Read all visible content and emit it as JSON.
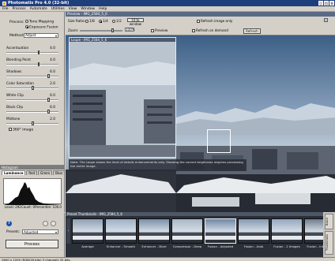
{
  "app": {
    "title": "Photomatix Pro 4.0 (32-bit)",
    "window_buttons": [
      "_",
      "□",
      "×"
    ]
  },
  "menu": [
    "File",
    "Process",
    "Automate",
    "Utilities",
    "View",
    "Window",
    "Help"
  ],
  "left_panel": {
    "process_label": "Process:",
    "process_options": [
      {
        "label": "Tone Mapping",
        "selected": false
      },
      {
        "label": "Exposure Fusion",
        "selected": true
      }
    ],
    "method_label": "Method:",
    "method_value": "Adjust",
    "sliders": [
      {
        "label": "Accentuation",
        "value": "4.0",
        "fraction": 0.62
      },
      {
        "label": "Blending Point",
        "value": "4.0",
        "fraction": 0.62
      },
      {
        "label": "Shadows",
        "value": "6.0",
        "fraction": 0.82
      },
      {
        "label": "Color Saturation",
        "value": "2.0",
        "fraction": 0.5
      },
      {
        "label": "White Clip",
        "value": "6.0",
        "fraction": 0.82
      },
      {
        "label": "Black Clip",
        "value": "6.0",
        "fraction": 0.82
      },
      {
        "label": "Midtone",
        "value": "2.0",
        "fraction": 0.5
      }
    ],
    "checkbox_360": "360° image"
  },
  "histogram": {
    "title": "Histogram",
    "tabs": [
      "Luminance",
      "Red",
      "Green",
      "Blue"
    ],
    "active_tab": "Luminance",
    "stats": {
      "level": "Level: 292",
      "count": "Count: 0",
      "percentile": "Percentile: 100.0"
    }
  },
  "lower_left": {
    "help_icon": "?",
    "presets_label": "Presets:",
    "presets_value": "Adjusted",
    "process_button": "Process"
  },
  "preview": {
    "title": "Preview - IMG_2584_5_6",
    "size_ratio_label": "Size Ratio:",
    "size_ratio_options": [
      "1/8",
      "1/4",
      "1/2"
    ],
    "fit_button": "Fit to window",
    "zoom_label": "Zoom:",
    "zoom_value": "100%",
    "preview_checkbox": "Preview",
    "refresh_on_demand": "Refresh on demand",
    "refresh_image_only": "Refresh image only",
    "refresh_btn": "Refresh",
    "loupe_title": "Loupe - IMG_2584_5_6",
    "loupe_note": "Note: The Loupe shows the level of details enhancements only. Showing the correct brightness requires processing the entire image."
  },
  "thumbnails": {
    "title": "Preset Thumbnails - IMG_2584_5_6",
    "items": [
      {
        "label": "Average",
        "tint": "#8d9fb3"
      },
      {
        "label": "Enhancer - Smooth",
        "tint": "#9db0c6"
      },
      {
        "label": "Enhancer - More",
        "tint": "#7a8ea8"
      },
      {
        "label": "Compressor - Deep",
        "tint": "#a8b6c6"
      },
      {
        "label": "Fusion - Adjusted",
        "tint": "#6f86a6"
      },
      {
        "label": "Fusion - Auto",
        "tint": "#8598b2"
      },
      {
        "label": "Fusion - 2 Images",
        "tint": "#95a6be"
      },
      {
        "label": "Fusion - Intensive",
        "tint": "#707c8e"
      }
    ],
    "selected_index": 4
  },
  "side_tabs": [
    "Batch",
    "Thumbnails"
  ],
  "status": "1600 x 1200 (RGB/16 bits) 3 channels 32 bits",
  "colors": {
    "titlebar": "#1f3e7c",
    "panel": "#d4d0c8",
    "thumbs_bg": "#2a2f38"
  }
}
